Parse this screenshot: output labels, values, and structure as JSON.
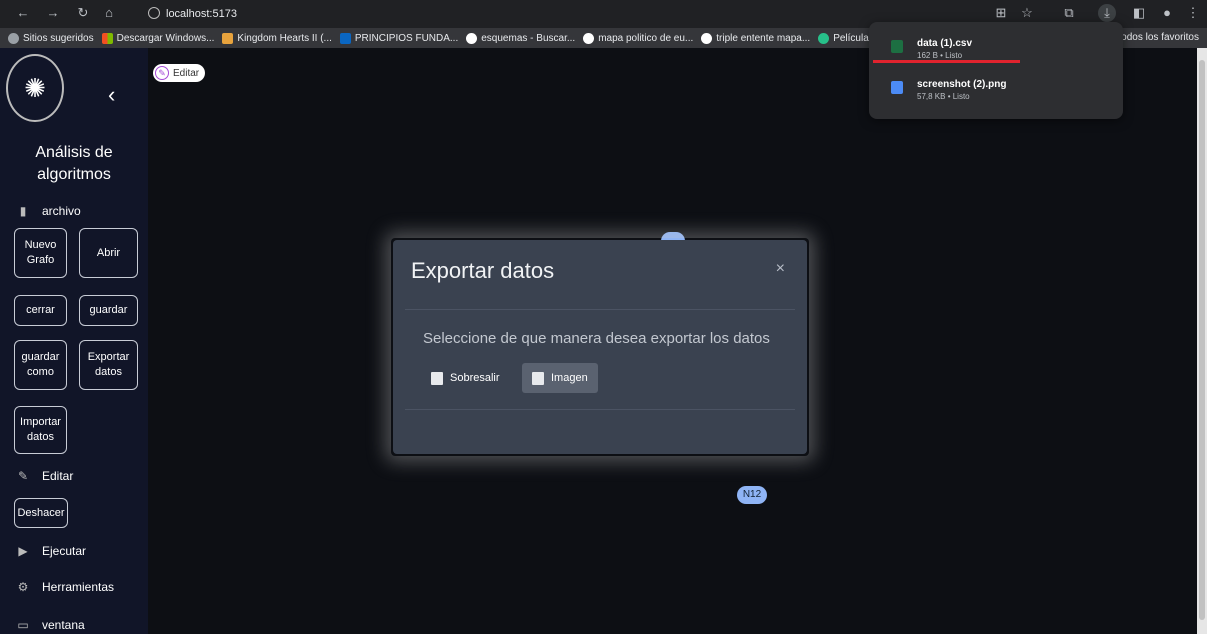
{
  "browser": {
    "address": "localhost:5173",
    "bookmarks": [
      {
        "label": "Sitios sugeridos",
        "icon": "globe-icon",
        "color": "#9aa0a6"
      },
      {
        "label": "Descargar Windows...",
        "icon": "windows-icon",
        "color": "#f25022"
      },
      {
        "label": "Kingdom Hearts II (...",
        "icon": "crown-icon",
        "color": "#e8a33d"
      },
      {
        "label": "PRINCIPIOS FUNDA...",
        "icon": "linkedin-icon",
        "color": "#0a66c2"
      },
      {
        "label": "esquemas - Buscar...",
        "icon": "google-icon",
        "color": "#ffffff"
      },
      {
        "label": "mapa politico de eu...",
        "icon": "google-icon",
        "color": "#ffffff"
      },
      {
        "label": "triple entente mapa...",
        "icon": "google-icon",
        "color": "#ffffff"
      },
      {
        "label": "Película",
        "icon": "c-icon",
        "color": "#27c08a"
      }
    ],
    "all_bookmarks": "Todos los favoritos"
  },
  "downloads": [
    {
      "name": "data (1).csv",
      "meta": "162 B • Listo",
      "icon": "excel-icon",
      "color": "#1d6f42"
    },
    {
      "name": "screenshot (2).png",
      "meta": "57,8 KB • Listo",
      "icon": "image-file-icon",
      "color": "#4c8bf5"
    }
  ],
  "sidebar": {
    "title": "Análisis de algoritmos",
    "archivo": "archivo",
    "nuevo_grafo": "Nuevo Grafo",
    "abrir": "Abrir",
    "cerrar": "cerrar",
    "guardar": "guardar",
    "guardar_como": "guardar como",
    "exportar_datos": "Exportar datos",
    "importar_datos": "Importar datos",
    "editar": "Editar",
    "deshacer": "Deshacer",
    "ejecutar": "Ejecutar",
    "herramientas": "Herramientas",
    "ventana": "ventana"
  },
  "canvas": {
    "edit_label": "Editar",
    "node_label": "N12"
  },
  "modal": {
    "title": "Exportar datos",
    "close": "×",
    "description": "Seleccione de que manera desea exportar los datos",
    "option_excel": "Sobresalir",
    "option_image": "Imagen"
  }
}
